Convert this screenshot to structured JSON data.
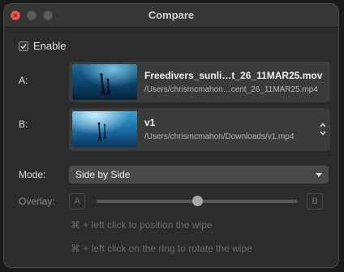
{
  "window": {
    "title": "Compare"
  },
  "enable": {
    "label": "Enable",
    "checked": true
  },
  "source_a": {
    "label": "A:",
    "name": "Freedivers_sunli…t_26_11MAR25.mov",
    "path": "/Users/chrismcmahon…cent_26_11MAR25.mp4"
  },
  "source_b": {
    "label": "B:",
    "name": "v1",
    "path": "/Users/chrismcmahon/Downloads/v1.mp4"
  },
  "mode": {
    "label": "Mode:",
    "value": "Side by Side"
  },
  "overlay": {
    "label": "Overlay:",
    "left_button": "A",
    "right_button": "B",
    "slider_value": 0.5
  },
  "hints": [
    "⌘ + left click to position the wipe",
    "⌘ + left click on the ring to rotate the wipe"
  ],
  "colors": {
    "accent_red": "#ee5a52",
    "window_bg": "#2c2c2c"
  }
}
